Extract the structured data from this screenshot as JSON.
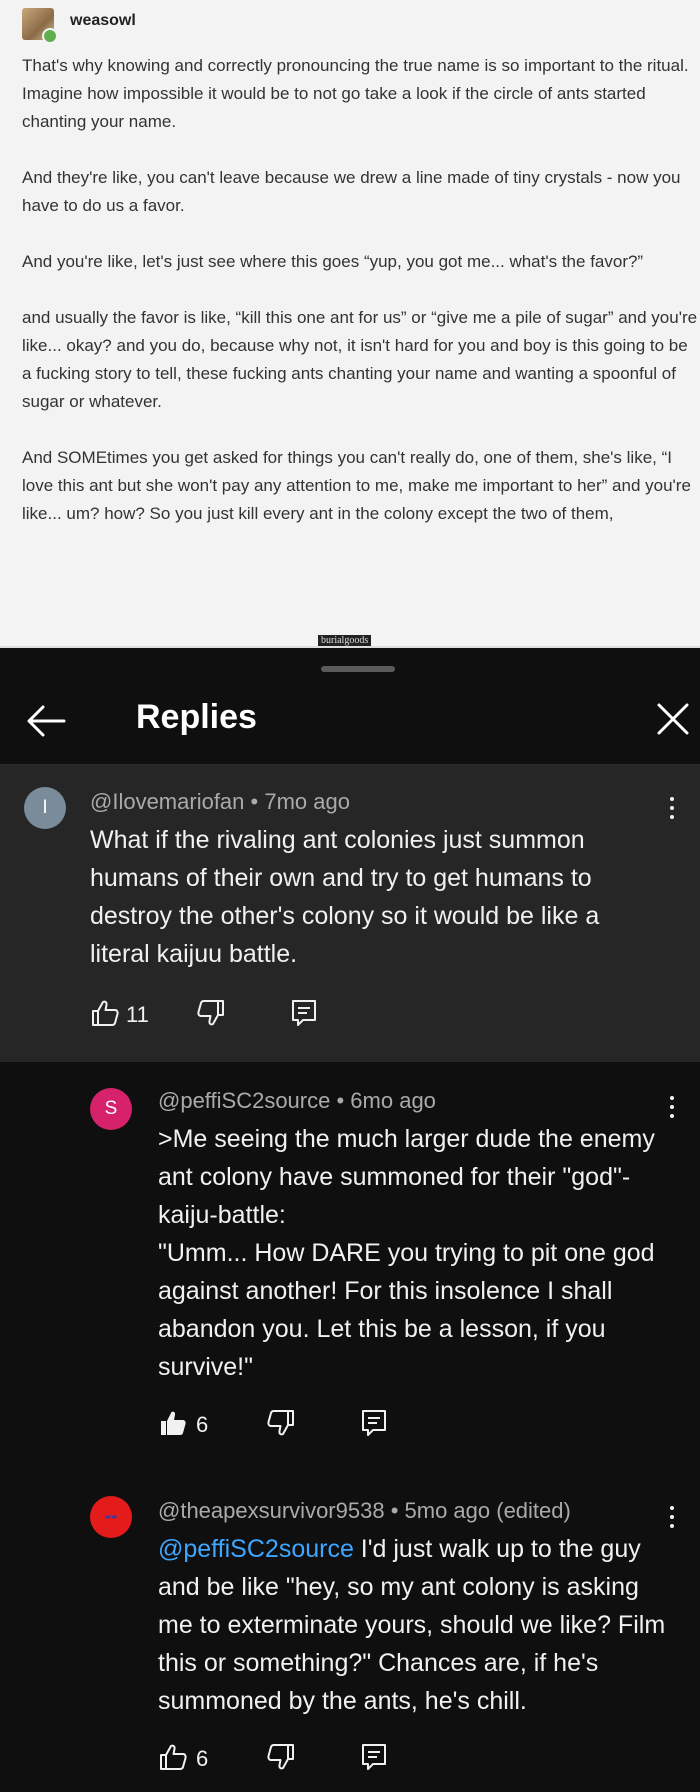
{
  "tumblr": {
    "username": "weasowl",
    "paragraphs": [
      "That's why knowing and correctly pronouncing the true name is so important to the ritual. Imagine how impossible it would be to not go take a look if the circle of ants started chanting your name.",
      "And they're like, you can't leave because we drew a line made of tiny crystals - now you have to do us a favor.",
      "And you're like, let's just see where this goes “yup, you got me... what's the favor?”",
      "and usually the favor is like, “kill this one ant for us” or “give me a pile of sugar” and you're like... okay? and you do, because why not, it isn't hard for you and boy is this going to be a fucking story to tell, these fucking ants chanting your name and wanting a spoonful of sugar or whatever.",
      "And SOMEtimes you get asked for things you can't really do, one of them, she's like, “I love this ant but she won't pay any attention to me, make me important to her” and you're like... um? how? So you just kill every ant in the colony except the two of them,"
    ],
    "watermark": "burialgoods"
  },
  "replies": {
    "title": "Replies",
    "parent": {
      "avatar_letter": "I",
      "avatar_color": "#7a8c99",
      "author": "@Ilovemariofan",
      "time": "7mo ago",
      "text": "What if the rivaling ant colonies just summon humans of their own and try to get humans to destroy the other's colony so it would be like a literal kaijuu battle.",
      "likes": "11"
    },
    "reply1": {
      "avatar_letter": "S",
      "avatar_color": "#d6216b",
      "author": "@peffiSC2source",
      "time": "6mo ago",
      "text": ">Me seeing the much larger dude the enemy ant colony have summoned for their \"god\"-kaiju-battle:\n\"Umm... How DARE you trying to pit one god against another! For this insolence I shall abandon you. Let this be a lesson, if you survive!\"",
      "likes": "6"
    },
    "reply2": {
      "avatar_color": "#e31b1b",
      "author": "@theapexsurvivor9538",
      "time": "5mo ago (edited)",
      "mention": "@peffiSC2source",
      "text": " I'd just walk up to the guy and be like \"hey, so my ant colony is asking me to exterminate yours, should we like? Film this or something?\" Chances are, if he's summoned by the ants, he's chill.",
      "likes": "6"
    },
    "separator": " • "
  }
}
